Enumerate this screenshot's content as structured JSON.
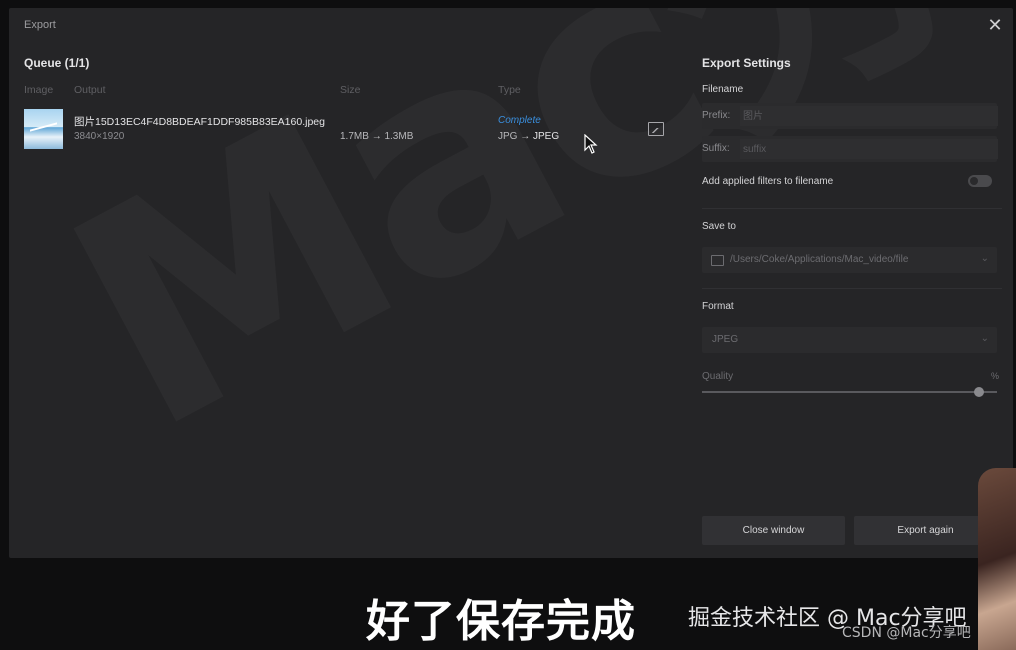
{
  "window": {
    "title": "Export"
  },
  "queue": {
    "title": "Queue (1/1)",
    "columns": {
      "image": "Image",
      "output": "Output",
      "size": "Size",
      "type": "Type"
    },
    "items": [
      {
        "filename": "图片15D13EC4F4D8BDEAF1DDF985B83EA160.jpeg",
        "dimensions": "3840×1920",
        "size_before": "1.7MB",
        "size_after": "1.3MB",
        "status": "Complete",
        "type_from": "JPG",
        "type_to": "JPEG",
        "arrow": "→"
      }
    ]
  },
  "settings": {
    "title": "Export Settings",
    "filename_label": "Filename",
    "prefix_label": "Prefix:",
    "prefix_placeholder": "图片",
    "suffix_label": "Suffix:",
    "suffix_placeholder": "suffix",
    "add_filters_label": "Add applied filters to filename",
    "add_filters_enabled": false,
    "save_to_label": "Save to",
    "save_to_path": "/Users/Coke/Applications/Mac_video/file",
    "format_label": "Format",
    "format_value": "JPEG",
    "quality_label": "Quality",
    "quality_value": "%",
    "quality_level": 0.94,
    "close_button": "Close window",
    "export_again_button": "Export again"
  },
  "overlay": {
    "watermark": "Mac分享吧",
    "subtitle": "好了保存完成",
    "brand": "掘金技术社区 @ Mac分享吧",
    "csdn": "CSDN @Mac分享吧"
  },
  "icons": {
    "close": "close-icon",
    "open_folder": "image-folder-icon",
    "chevron": "chevron-down-icon"
  }
}
